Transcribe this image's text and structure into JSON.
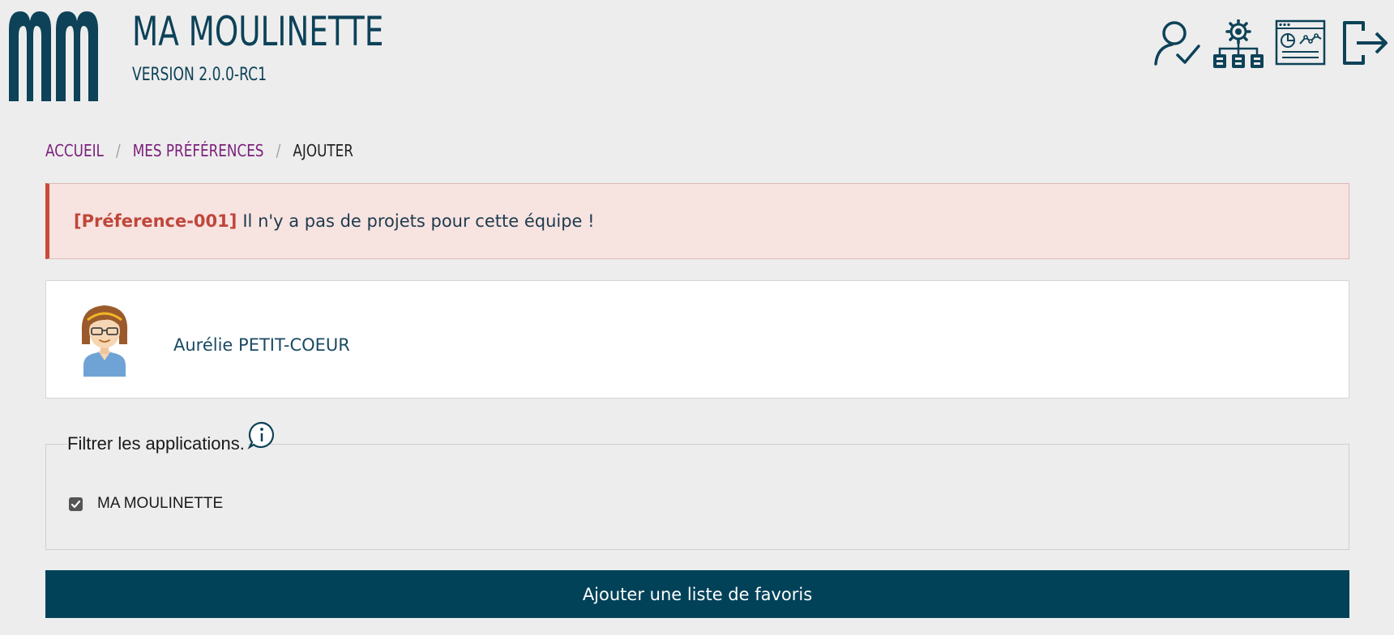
{
  "header": {
    "app_title": "MA MOULINETTE",
    "app_version": "VERSION 2.0.0-RC1",
    "icons": [
      "user-check-icon",
      "settings-network-icon",
      "dashboard-icon",
      "logout-icon"
    ]
  },
  "breadcrumb": {
    "items": [
      "ACCUEIL",
      "MES PRÉFÉRENCES",
      "AJOUTER"
    ],
    "separator": "/"
  },
  "alert": {
    "code": "[Préference-001]",
    "message": "Il n'y a pas de projets pour cette équipe !"
  },
  "user": {
    "name": "Aurélie PETIT-COEUR"
  },
  "filter": {
    "legend": "Filtrer les applications.",
    "options": [
      {
        "label": "MA MOULINETTE",
        "checked": true
      }
    ]
  },
  "actions": {
    "submit_label": "Ajouter une liste de favoris"
  },
  "colors": {
    "brand": "#014259",
    "breadcrumb_link": "#7b1f7b",
    "alert_bg": "#f7e3e0",
    "alert_accent": "#c94a3c",
    "page_bg": "#ededed"
  }
}
